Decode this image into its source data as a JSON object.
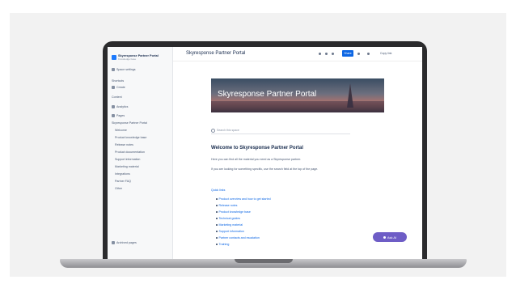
{
  "sidebar": {
    "space_name": "Skyresponse Partner Portal",
    "space_sub": "Knowledge base",
    "items": [
      "Space settings",
      "Shortcuts",
      "Create",
      "Content",
      "Analytics",
      "Pages",
      "Skyresponse Partner Portal"
    ],
    "tree": [
      "Welcome",
      "Product knowledge base",
      "Release notes",
      "Product documentation",
      "Support information",
      "Marketing material",
      "Integrations",
      "Partner FAQ",
      "Other"
    ],
    "footer": "Archived pages"
  },
  "topbar": {
    "page_title": "Skyresponse Partner Portal",
    "share_label": "Share",
    "link_label": "Copy link"
  },
  "banner": {
    "text": "Skyresponse Partner Portal"
  },
  "search": {
    "placeholder": "Search this space"
  },
  "content": {
    "welcome_title": "Welcome to Skyresponse Partner Portal",
    "para1": "Here you can find all the material you need as a Skyresponse partner.",
    "para2": "If you are looking for something specific, use the search field at the top of the page.",
    "links_heading": "Quick links",
    "links": [
      "Product overview and how to get started",
      "Release notes",
      "Product knowledge base",
      "Technical guides",
      "Marketing material",
      "Support information",
      "Partner contacts and escalation",
      "Training"
    ]
  },
  "fab": {
    "label": "Ask AI"
  },
  "colors": {
    "accent": "#0c66e4",
    "fab": "#6e5dc6",
    "laptop": "#2b2b2d"
  }
}
